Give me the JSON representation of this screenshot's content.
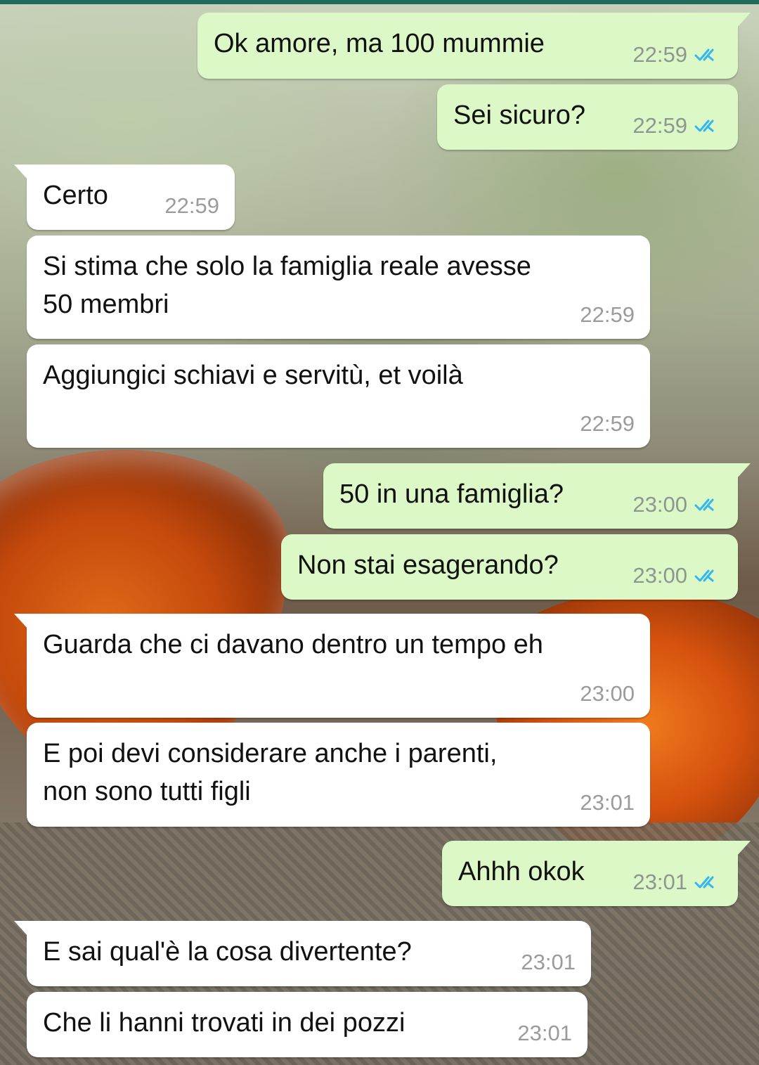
{
  "colors": {
    "outgoing_bubble": "#dcf8c6",
    "incoming_bubble": "#ffffff",
    "read_ticks": "#34b7f1",
    "timestamp": "#8d968f"
  },
  "icons": {
    "read_receipt": "double-check-icon"
  },
  "messages": [
    {
      "direction": "outgoing",
      "text": "Ok amore, ma 100 mummie",
      "time": "22:59",
      "status": "read"
    },
    {
      "direction": "outgoing",
      "text": "Sei sicuro?",
      "time": "22:59",
      "status": "read"
    },
    {
      "direction": "incoming",
      "text": "Certo",
      "time": "22:59"
    },
    {
      "direction": "incoming",
      "text": "Si stima che solo la famiglia reale avesse\n50 membri",
      "time": "22:59"
    },
    {
      "direction": "incoming",
      "text": "Aggiungici schiavi e servitù, et voilà",
      "time": "22:59"
    },
    {
      "direction": "outgoing",
      "text": "50 in una famiglia?",
      "time": "23:00",
      "status": "read"
    },
    {
      "direction": "outgoing",
      "text": "Non stai esagerando?",
      "time": "23:00",
      "status": "read"
    },
    {
      "direction": "incoming",
      "text": "Guarda che ci davano dentro un tempo eh",
      "time": "23:00"
    },
    {
      "direction": "incoming",
      "text": "E poi devi considerare anche i parenti,\nnon sono tutti figli",
      "time": "23:01"
    },
    {
      "direction": "outgoing",
      "text": "Ahhh okok",
      "time": "23:01",
      "status": "read"
    },
    {
      "direction": "incoming",
      "text": "E sai qual'è la cosa divertente?",
      "time": "23:01"
    },
    {
      "direction": "incoming",
      "text": "Che li hanni trovati in dei pozzi",
      "time": "23:01"
    }
  ]
}
